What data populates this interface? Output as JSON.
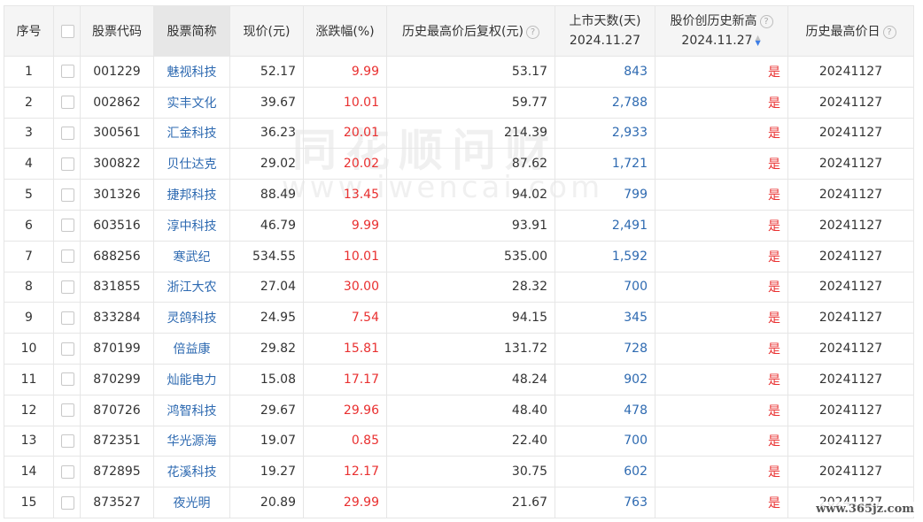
{
  "headers": {
    "index": "序号",
    "code": "股票代码",
    "name": "股票简称",
    "price": "现价(元)",
    "change": "涨跌幅(%)",
    "hist_high": "历史最高价后复权(元)",
    "days_line1": "上市天数(天)",
    "days_line2": "2024.11.27",
    "new_high_line1": "股价创历史新高",
    "new_high_line2": "2024.11.27",
    "high_date": "历史最高价日"
  },
  "rows": [
    {
      "index": "1",
      "code": "001229",
      "name": "魅视科技",
      "price": "52.17",
      "change": "9.99",
      "hist_high": "53.17",
      "days": "843",
      "new_high": "是",
      "high_date": "20241127"
    },
    {
      "index": "2",
      "code": "002862",
      "name": "实丰文化",
      "price": "39.67",
      "change": "10.01",
      "hist_high": "59.77",
      "days": "2,788",
      "new_high": "是",
      "high_date": "20241127"
    },
    {
      "index": "3",
      "code": "300561",
      "name": "汇金科技",
      "price": "36.23",
      "change": "20.01",
      "hist_high": "214.39",
      "days": "2,933",
      "new_high": "是",
      "high_date": "20241127"
    },
    {
      "index": "4",
      "code": "300822",
      "name": "贝仕达克",
      "price": "29.02",
      "change": "20.02",
      "hist_high": "87.62",
      "days": "1,721",
      "new_high": "是",
      "high_date": "20241127"
    },
    {
      "index": "5",
      "code": "301326",
      "name": "捷邦科技",
      "price": "88.49",
      "change": "13.45",
      "hist_high": "94.02",
      "days": "799",
      "new_high": "是",
      "high_date": "20241127"
    },
    {
      "index": "6",
      "code": "603516",
      "name": "淳中科技",
      "price": "46.79",
      "change": "9.99",
      "hist_high": "93.91",
      "days": "2,491",
      "new_high": "是",
      "high_date": "20241127"
    },
    {
      "index": "7",
      "code": "688256",
      "name": "寒武纪",
      "price": "534.55",
      "change": "10.01",
      "hist_high": "535.00",
      "days": "1,592",
      "new_high": "是",
      "high_date": "20241127"
    },
    {
      "index": "8",
      "code": "831855",
      "name": "浙江大农",
      "price": "27.04",
      "change": "30.00",
      "hist_high": "28.32",
      "days": "700",
      "new_high": "是",
      "high_date": "20241127"
    },
    {
      "index": "9",
      "code": "833284",
      "name": "灵鸽科技",
      "price": "24.95",
      "change": "7.54",
      "hist_high": "94.15",
      "days": "345",
      "new_high": "是",
      "high_date": "20241127"
    },
    {
      "index": "10",
      "code": "870199",
      "name": "倍益康",
      "price": "29.82",
      "change": "15.81",
      "hist_high": "131.72",
      "days": "728",
      "new_high": "是",
      "high_date": "20241127"
    },
    {
      "index": "11",
      "code": "870299",
      "name": "灿能电力",
      "price": "15.08",
      "change": "17.17",
      "hist_high": "48.24",
      "days": "902",
      "new_high": "是",
      "high_date": "20241127"
    },
    {
      "index": "12",
      "code": "870726",
      "name": "鸿智科技",
      "price": "29.67",
      "change": "29.96",
      "hist_high": "48.40",
      "days": "478",
      "new_high": "是",
      "high_date": "20241127"
    },
    {
      "index": "13",
      "code": "872351",
      "name": "华光源海",
      "price": "19.07",
      "change": "0.85",
      "hist_high": "22.40",
      "days": "700",
      "new_high": "是",
      "high_date": "20241127"
    },
    {
      "index": "14",
      "code": "872895",
      "name": "花溪科技",
      "price": "19.27",
      "change": "12.17",
      "hist_high": "30.75",
      "days": "602",
      "new_high": "是",
      "high_date": "20241127"
    },
    {
      "index": "15",
      "code": "873527",
      "name": "夜光明",
      "price": "20.89",
      "change": "29.99",
      "hist_high": "21.67",
      "days": "763",
      "new_high": "是",
      "high_date": "20241127"
    }
  ],
  "watermark": {
    "main": "同花顺问财",
    "sub": "www.iwencai.com"
  },
  "corner_watermark": "www.365jz.com",
  "colors": {
    "positive": "#e93030",
    "link": "#2e6ab1",
    "header_bg": "#f5f5f5",
    "sort_active": "#3d7ee6"
  },
  "icons": {
    "help": "question-circle-icon",
    "sort": "sort-desc-icon",
    "checkbox": "checkbox-icon"
  }
}
